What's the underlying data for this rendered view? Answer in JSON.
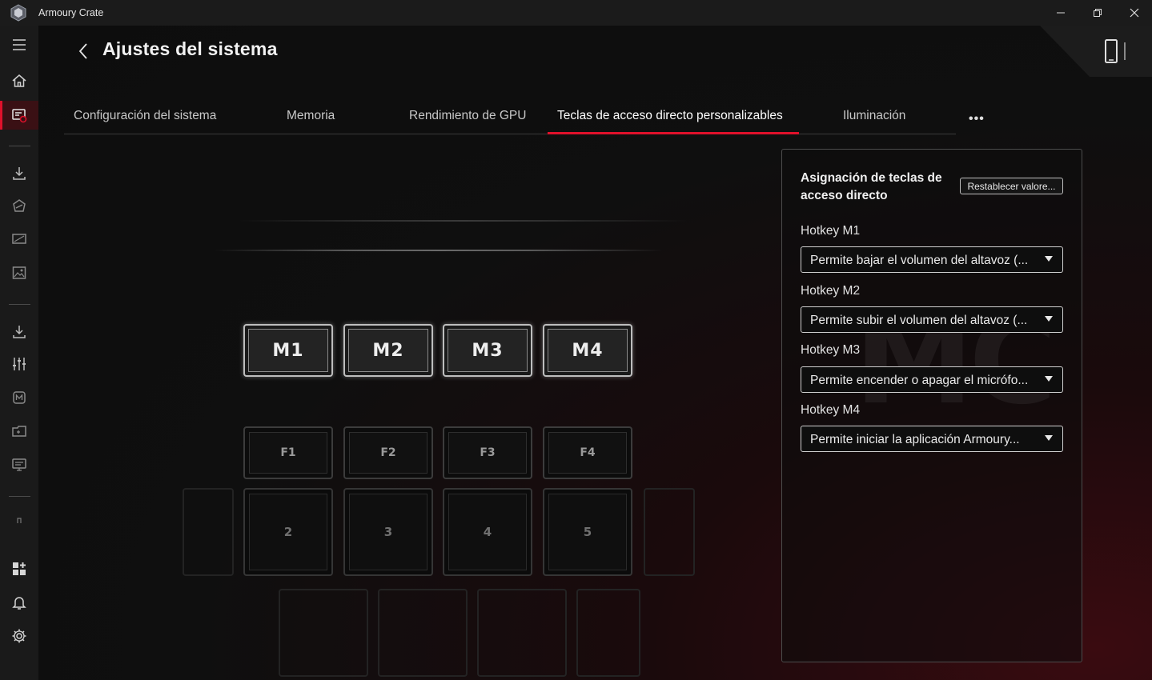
{
  "window": {
    "title": "Armoury Crate",
    "controls": [
      "minimize-icon",
      "restore-icon",
      "close-icon"
    ]
  },
  "sidebar": {
    "items": [
      {
        "icon": "hamburger-menu-icon"
      },
      {
        "icon": "home-icon"
      },
      {
        "icon": "device-settings-icon",
        "active": true
      },
      {
        "icon": "download-icon"
      },
      {
        "icon": "aura-icon"
      },
      {
        "icon": "display-icon"
      },
      {
        "icon": "gallery-icon"
      },
      {
        "icon": "download-center-icon"
      },
      {
        "icon": "equalizer-icon"
      },
      {
        "icon": "macro-icon"
      },
      {
        "icon": "game-library-icon"
      },
      {
        "icon": "monitor-icon"
      },
      {
        "icon": "small-item-icon"
      },
      {
        "icon": "featured-apps-icon"
      },
      {
        "icon": "notifications-icon"
      },
      {
        "icon": "settings-gear-icon"
      }
    ]
  },
  "header": {
    "title": "Ajustes del sistema",
    "device_icon": "device-phone-icon"
  },
  "tabs": [
    {
      "label": "Configuración del sistema",
      "active": false
    },
    {
      "label": "Memoria",
      "active": false
    },
    {
      "label": "Rendimiento de GPU",
      "active": false
    },
    {
      "label": "Teclas de acceso directo personalizables",
      "active": true
    },
    {
      "label": "Iluminación",
      "active": false
    }
  ],
  "tab_more": "•••",
  "keyboard": {
    "macro_keys": [
      "M1",
      "M2",
      "M3",
      "M4"
    ],
    "function_keys": [
      "F1",
      "F2",
      "F3",
      "F4"
    ],
    "number_keys": [
      "2",
      "3",
      "4",
      "5"
    ]
  },
  "hotkey_panel": {
    "title": "Asignación de teclas de acceso directo",
    "reset_label": "Restablecer valore...",
    "watermark": "MC",
    "hotkeys": [
      {
        "label": "Hotkey M1",
        "value": "Permite bajar el volumen del altavoz (..."
      },
      {
        "label": "Hotkey M2",
        "value": "Permite subir el volumen del altavoz (..."
      },
      {
        "label": "Hotkey M3",
        "value": "Permite encender o apagar el micrófo..."
      },
      {
        "label": "Hotkey M4",
        "value": "Permite iniciar la aplicación Armoury..."
      }
    ]
  },
  "colors": {
    "accent": "#e0112b",
    "background": "#0d0d0d",
    "sidebar": "#1a1a1a",
    "titlebar": "#1b1b1b"
  }
}
